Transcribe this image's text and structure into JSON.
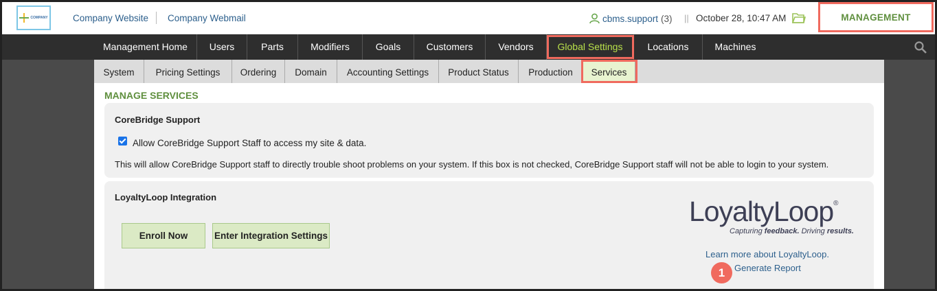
{
  "header": {
    "logo_text": "COMPANY",
    "links": [
      "Company Website",
      "Company Webmail"
    ],
    "user_name": "cbms.support",
    "user_count": "(3)",
    "separator": "||",
    "datetime": "October 28, 10:47 AM",
    "management_label": "MANAGEMENT"
  },
  "nav": {
    "items": [
      "Management Home",
      "Users",
      "Parts",
      "Modifiers",
      "Goals",
      "Customers",
      "Vendors",
      "Global Settings",
      "Locations",
      "Machines"
    ],
    "active": "Global Settings"
  },
  "subnav": {
    "items": [
      "System",
      "Pricing Settings",
      "Ordering",
      "Domain",
      "Accounting Settings",
      "Product Status",
      "Production",
      "Services"
    ],
    "active": "Services"
  },
  "page": {
    "title": "MANAGE SERVICES"
  },
  "support": {
    "title": "CoreBridge Support",
    "checkbox_label": "Allow CoreBridge Support Staff to access my site & data.",
    "checkbox_checked": true,
    "description": "This will allow CoreBridge Support staff to directly trouble shoot problems on your system. If this box is not checked, CoreBridge Support staff will not be able to login to your system."
  },
  "loyalty": {
    "title": "LoyaltyLoop Integration",
    "enroll_label": "Enroll Now",
    "settings_label": "Enter Integration Settings",
    "logo_text": "LoyaltyLoop",
    "logo_reg": "®",
    "tagline_pre": "Capturing ",
    "tagline_b1": "feedback.",
    "tagline_mid": " Driving ",
    "tagline_b2": "results.",
    "learn_more": "Learn more about LoyaltyLoop.",
    "generate_report": "Generate Report"
  },
  "annotation": {
    "badge": "1"
  },
  "colors": {
    "accent_green": "#5f8f3e",
    "nav_active": "#b8e04a",
    "highlight": "#f06a5e",
    "link": "#2c5f8c"
  }
}
